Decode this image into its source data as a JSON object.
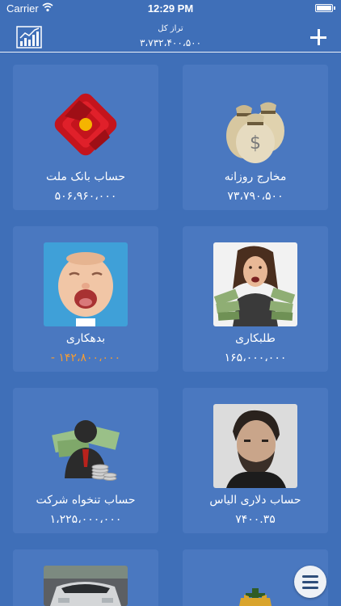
{
  "status_bar": {
    "carrier": "Carrier",
    "time": "12:29 PM"
  },
  "header": {
    "title": "تراز کل",
    "balance": "۳،۷۳۲،۴۰۰،۵۰۰"
  },
  "cards": [
    {
      "label": "مخارج روزانه",
      "value": "۷۳،۷۹۰،۵۰۰",
      "image": "money-bags",
      "negative": false
    },
    {
      "label": "حساب بانک ملت",
      "value": "۵۰۶،۹۶۰،۰۰۰",
      "image": "bank-mellat-logo",
      "negative": false
    },
    {
      "label": "طلبکاری",
      "value": "۱۶۵،۰۰۰،۰۰۰",
      "image": "woman-with-cash-photo",
      "negative": false
    },
    {
      "label": "بدهکاری",
      "value": "- ۱۴۲،۸۰۰،۰۰۰",
      "image": "crying-baby-photo",
      "negative": true
    },
    {
      "label": "حساب دلاری الیاس",
      "value": "۷۴۰۰.۳۵",
      "image": "man-portrait-photo",
      "negative": false
    },
    {
      "label": "حساب تنخواه شرکت",
      "value": "۱،۲۲۵،۰۰۰،۰۰۰",
      "image": "businessman-with-money",
      "negative": false
    },
    {
      "label": "",
      "value": "",
      "image": "emblem",
      "negative": false
    },
    {
      "label": "",
      "value": "",
      "image": "car-photo",
      "negative": false
    }
  ],
  "colors": {
    "background": "#3f6fb8",
    "card": "#4a78c0",
    "negative_value": "#f39c34",
    "text": "#ffffff"
  }
}
